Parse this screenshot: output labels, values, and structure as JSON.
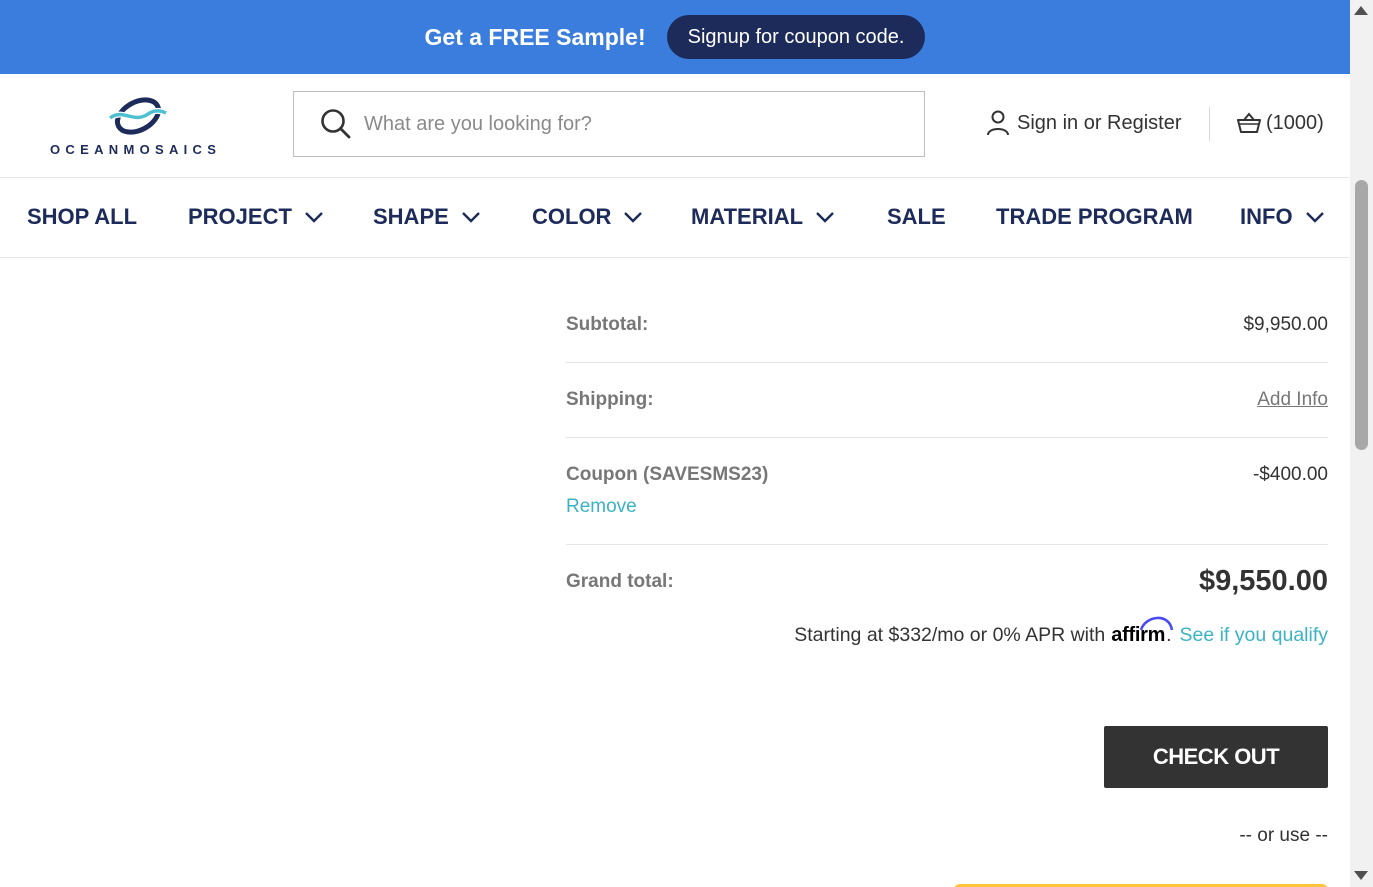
{
  "promo": {
    "title": "Get a FREE Sample!",
    "button_label": "Signup for coupon code."
  },
  "header": {
    "logo_text": "OCEANMOSAICS",
    "search_placeholder": "What are you looking for?",
    "account_label": "Sign in or Register",
    "cart_count": "(1000)"
  },
  "nav": {
    "items": [
      {
        "label": "SHOP ALL",
        "dropdown": false
      },
      {
        "label": "PROJECT",
        "dropdown": true
      },
      {
        "label": "SHAPE",
        "dropdown": true
      },
      {
        "label": "COLOR",
        "dropdown": true
      },
      {
        "label": "MATERIAL",
        "dropdown": true
      },
      {
        "label": "SALE",
        "dropdown": false
      },
      {
        "label": "TRADE PROGRAM",
        "dropdown": false
      },
      {
        "label": "INFO",
        "dropdown": true
      }
    ]
  },
  "summary": {
    "subtotal_label": "Subtotal:",
    "subtotal_value": "$9,950.00",
    "shipping_label": "Shipping:",
    "shipping_link": "Add Info",
    "coupon_label": "Coupon (SAVESMS23)",
    "coupon_value": "-$400.00",
    "coupon_remove": "Remove",
    "grand_label": "Grand total:",
    "grand_value": "$9,550.00"
  },
  "affirm": {
    "text": "Starting at $332/mo or 0% APR with",
    "logo": "affirm",
    "period": ".",
    "link": "See if you qualify"
  },
  "checkout_label": "CHECK OUT",
  "or_use": "-- or use --",
  "colors": {
    "promo_bg": "#3b7ddd",
    "navy": "#1d2b5a",
    "teal_link": "#3bb3c3",
    "checkout_bg": "#333333",
    "paypal_yellow": "#ffc439"
  }
}
